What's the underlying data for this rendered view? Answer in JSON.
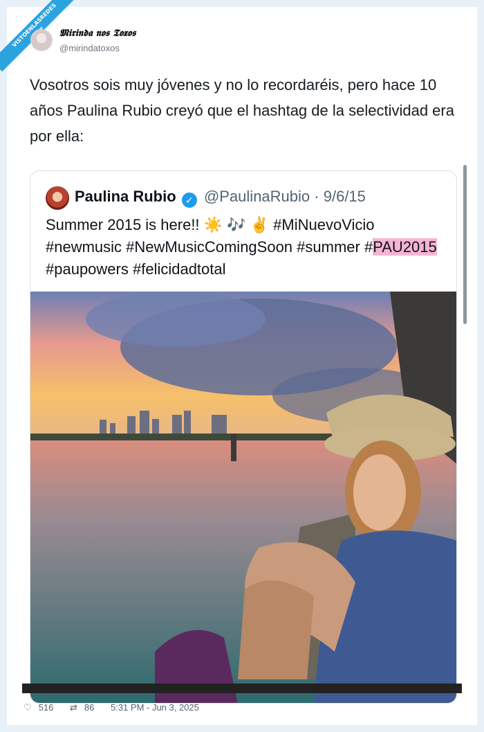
{
  "watermark": {
    "line1": "VISTOENLASREDES",
    "line2": ".com"
  },
  "author": {
    "name": "𝕸𝖎𝖗𝖎𝖓𝖉𝖆 𝖓𝖔𝖘 𝕿𝖔𝖝𝖔𝖘",
    "handle": "@mirindatoxos"
  },
  "tweet": {
    "text": "Vosotros sois muy jóvenes y no lo recordaréis, pero hace 10 años Paulina Rubio creyó que el hashtag de la selectividad era por ella:"
  },
  "quoted": {
    "name": "Paulina Rubio",
    "handle": "@PaulinaRubio",
    "separator": "·",
    "date": "9/6/15",
    "text_before": "Summer 2015 is here!! ☀️ 🎶 ✌️ #MiNuevoVicio #newmusic #NewMusicComingSoon #summer #",
    "highlight": "PAU2015",
    "text_after": " #paupowers #felicidadtotal"
  },
  "footer": {
    "likes": "516",
    "retweets": "86",
    "timestamp": "5:31 PM - Jun 3, 2025"
  },
  "icons": [
    "heart-icon",
    "retweet-icon",
    "verified-badge-icon"
  ],
  "colors": {
    "accent": "#1d9bf0",
    "highlight": "#f6b4d2",
    "ribbon": "#2aa3de"
  }
}
